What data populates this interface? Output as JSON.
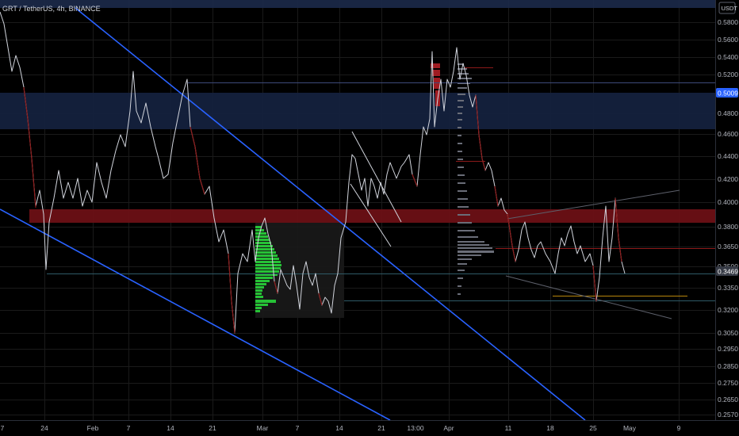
{
  "header": {
    "symbol": "GRT / TetherUS",
    "interval": "4h",
    "exchange": "BINANCE"
  },
  "chart_data": {
    "type": "line",
    "price_currency": "USDT",
    "y_axis_ticks": [
      "0.5800",
      "0.5600",
      "0.5400",
      "0.5200",
      "0.4800",
      "0.4600",
      "0.4400",
      "0.4200",
      "0.4000",
      "0.3800",
      "0.3650",
      "0.3500",
      "0.3350",
      "0.3200",
      "0.3050",
      "0.2950",
      "0.2850",
      "0.2750",
      "0.2650",
      "0.2570"
    ],
    "x_axis_ticks": [
      "7",
      "24",
      "Feb",
      "7",
      "14",
      "21",
      "Mar",
      "7",
      "14",
      "21",
      "13:00",
      "Apr",
      "11",
      "18",
      "25",
      "May",
      "9"
    ],
    "price_labels": [
      {
        "value": "0.5009",
        "color": "#2962ff"
      },
      {
        "value": "0.3469",
        "color": "#363a45"
      }
    ],
    "last_price": 0.3469,
    "ylim": [
      0.257,
      0.59
    ],
    "x_points": [
      "7",
      "24",
      "Feb",
      "7",
      "14",
      "21",
      "Mar",
      "7",
      "14",
      "21",
      "Apr",
      "11",
      "18",
      "25"
    ],
    "close": [
      0.42,
      0.386,
      0.395,
      0.44,
      0.49,
      0.4,
      0.333,
      0.347,
      0.44,
      0.395,
      0.535,
      0.38,
      0.365,
      0.347
    ],
    "zones": [
      {
        "name": "resistance-zone",
        "y_range": [
          0.466,
          0.509
        ],
        "color": "#1c2a4a"
      },
      {
        "name": "support-zone",
        "y_range": [
          0.384,
          0.392
        ],
        "color": "#7a1216"
      }
    ],
    "colors": {
      "up": "#ffffff",
      "down": "#8c1a1a",
      "trendline": "#2962ff",
      "volume_profile_up": "#26c236"
    }
  }
}
